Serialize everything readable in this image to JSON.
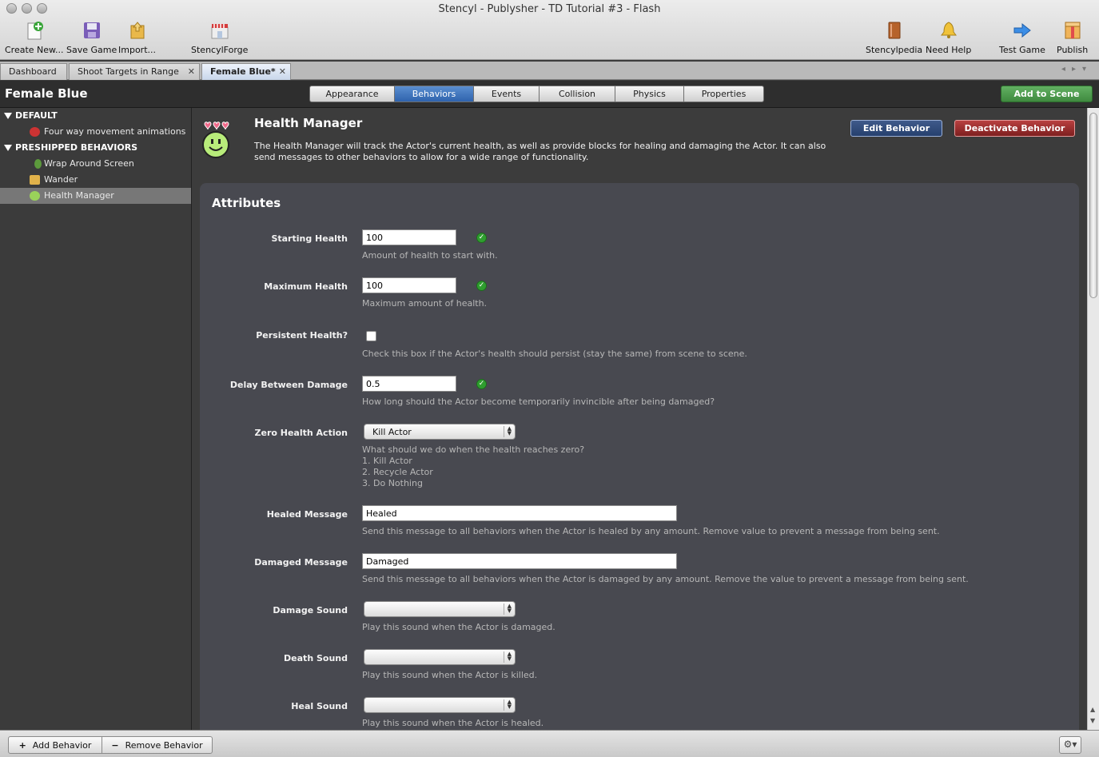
{
  "window": {
    "title": "Stencyl - Publysher - TD Tutorial #3 - Flash"
  },
  "toolbar": {
    "create_new": "Create New...",
    "save_game": "Save Game",
    "import": "Import...",
    "stencylforge": "StencylForge",
    "stencylpedia": "Stencylpedia",
    "need_help": "Need Help",
    "test_game": "Test Game",
    "publish": "Publish"
  },
  "doc_tabs": [
    {
      "label": "Dashboard"
    },
    {
      "label": "Shoot Targets in Range"
    },
    {
      "label": "Female Blue*"
    }
  ],
  "header": {
    "actor_name": "Female Blue",
    "tabs": [
      "Appearance",
      "Behaviors",
      "Events",
      "Collision",
      "Physics",
      "Properties"
    ],
    "active_tab": "Behaviors",
    "add_to_scene": "Add to Scene"
  },
  "sidebar": {
    "sections": [
      {
        "title": "DEFAULT",
        "items": [
          "Four way movement animations"
        ]
      },
      {
        "title": "PRESHIPPED BEHAVIORS",
        "items": [
          "Wrap Around Screen",
          "Wander",
          "Health Manager"
        ]
      }
    ],
    "selected": "Health Manager"
  },
  "behavior": {
    "title": "Health Manager",
    "description": "The Health Manager will track the Actor's current health, as well as provide blocks for healing and damaging the Actor. It can also send messages to other behaviors to allow for a wide range of functionality.",
    "edit_button": "Edit Behavior",
    "deactivate_button": "Deactivate Behavior"
  },
  "attributes": {
    "heading": "Attributes",
    "starting_health": {
      "label": "Starting Health",
      "value": "100",
      "help": "Amount of health to start with."
    },
    "maximum_health": {
      "label": "Maximum Health",
      "value": "100",
      "help": "Maximum amount of health."
    },
    "persistent_health": {
      "label": "Persistent Health?",
      "checked": false,
      "help": "Check this box if the Actor's health should persist (stay the same) from scene to scene."
    },
    "delay_between_damage": {
      "label": "Delay Between Damage",
      "value": "0.5",
      "help": "How long should the Actor become temporarily invincible after being damaged?"
    },
    "zero_health_action": {
      "label": "Zero Health Action",
      "value": "Kill Actor",
      "help_lines": [
        "What should we do when the health reaches zero?",
        "1. Kill Actor",
        "2. Recycle Actor",
        "3. Do Nothing"
      ]
    },
    "healed_message": {
      "label": "Healed Message",
      "value": "Healed",
      "help": "Send this message to all behaviors when the Actor is healed by any amount. Remove value to prevent a message from being sent."
    },
    "damaged_message": {
      "label": "Damaged Message",
      "value": "Damaged",
      "help": "Send this message to all behaviors when the Actor is damaged by any amount. Remove the value to prevent a message from being sent."
    },
    "damage_sound": {
      "label": "Damage Sound",
      "value": "",
      "help": "Play this sound when the Actor is damaged."
    },
    "death_sound": {
      "label": "Death Sound",
      "value": "",
      "help": "Play this sound when the Actor is killed."
    },
    "heal_sound": {
      "label": "Heal Sound",
      "value": "",
      "help": "Play this sound when the Actor is healed."
    }
  },
  "bottom": {
    "add_behavior": "Add Behavior",
    "remove_behavior": "Remove Behavior"
  },
  "colors": {
    "active_tab": "#3a6fb8",
    "add_scene": "#4e9d4e",
    "edit": "#2f4b7a",
    "deactivate": "#9a2e2e"
  }
}
